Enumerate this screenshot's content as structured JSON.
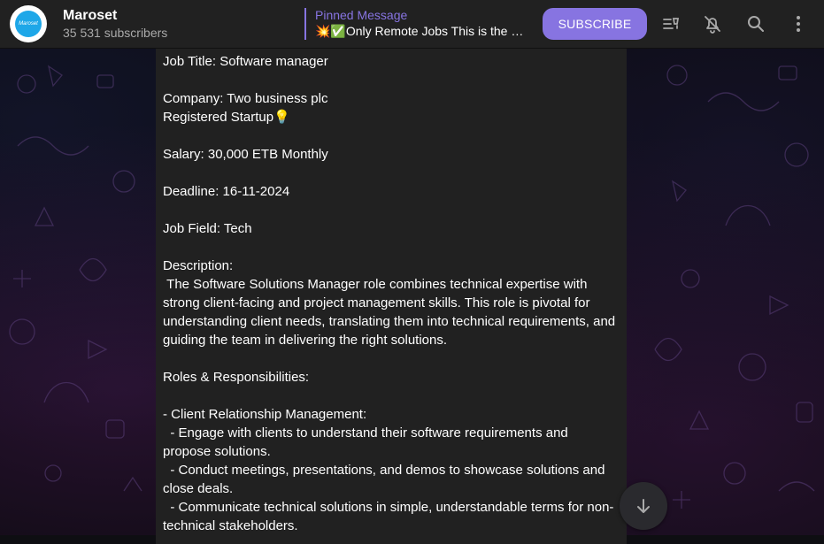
{
  "header": {
    "avatar_text": "Maroset",
    "channel_name": "Maroset",
    "subscribers": "35 531 subscribers",
    "pinned_title": "Pinned Message",
    "pinned_text": "💥✅Only Remote Jobs This is the o...",
    "subscribe_label": "SUBSCRIBE",
    "icons": [
      "voice-chat-icon",
      "mute-bell-icon",
      "search-icon",
      "more-vertical-icon"
    ]
  },
  "message": {
    "text": "Job Title: Software manager\n\nCompany: Two business plc\nRegistered Startup💡\n\nSalary: 30,000 ETB Monthly\n\nDeadline: 16-11-2024\n\nJob Field: Tech\n\nDescription:\n The Software Solutions Manager role combines technical expertise with strong client-facing and project management skills. This role is pivotal for understanding client needs, translating them into technical requirements, and guiding the team in delivering the right solutions.\n\nRoles & Responsibilities:\n\n- Client Relationship Management:\n  - Engage with clients to understand their software requirements and propose solutions.\n  - Conduct meetings, presentations, and demos to showcase solutions and close deals.\n  - Communicate technical solutions in simple, understandable terms for non-technical stakeholders."
  },
  "scroll_button_icon": "arrow-down-icon",
  "colors": {
    "accent": "#8774e1",
    "header_bg": "#212121",
    "bubble_bg": "#212121",
    "secondary_text": "#aaaaaa"
  }
}
